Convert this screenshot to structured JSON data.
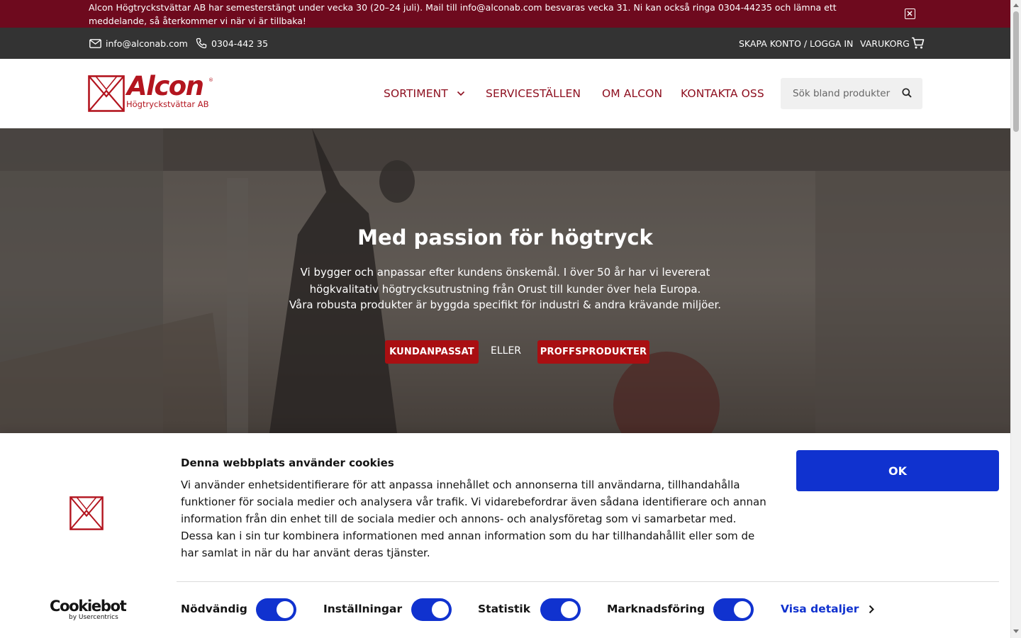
{
  "announcement": {
    "text": "Alcon Högtryckstvättar AB har semesterstängt under vecka 30 (20–24 juli). Mail till info@alconab.com besvaras vecka 31. Ni kan också ringa 0304-44235 och lämna ett meddelande, så återkommer vi när vi är tillbaka!"
  },
  "topbar": {
    "email": "info@alconab.com",
    "phone": "0304-442 35",
    "account": "SKAPA KONTO / LOGGA IN",
    "cart": "VARUKORG"
  },
  "header": {
    "logo_text": "Alcon",
    "logo_subtitle": "Högtryckstvättar AB",
    "logo_reg": "®",
    "nav": [
      "SORTIMENT",
      "SERVICESTÄLLEN",
      "OM ALCON",
      "KONTAKTA OSS"
    ],
    "search_placeholder": "Sök bland produkter"
  },
  "hero": {
    "title": "Med passion för högtryck",
    "lines": [
      "Vi bygger och anpassar efter kundens önskemål. I över 50 år har vi levererat",
      "högkvalitativ högtrycksutrustning från Orust till kunder över hela Europa.",
      "Våra robusta produkter är byggda specifikt för industri & andra krävande miljöer."
    ],
    "button_custom": "KUNDANPASSAT",
    "or_text": "ELLER",
    "button_pro": "PROFFSPRODUKTER"
  },
  "cookie": {
    "title": "Denna webbplats använder cookies",
    "body": "Vi använder enhetsidentifierare för att anpassa innehållet och annonserna till användarna, tillhandahålla funktioner för sociala medier och analysera vår trafik. Vi vidarebefordrar även sådana identifierare och annan information från din enhet till de sociala medier och annons- och analysföretag som vi samarbetar med. Dessa kan i sin tur kombinera informationen med annan information som du har tillhandahållit eller som de har samlat in när du har använt deras tjänster.",
    "ok": "OK",
    "brand": "Cookiebot",
    "brand_sub": "by Usercentrics",
    "categories": [
      {
        "label": "Nödvändig",
        "checked": true
      },
      {
        "label": "Inställningar",
        "checked": true
      },
      {
        "label": "Statistik",
        "checked": true
      },
      {
        "label": "Marknadsföring",
        "checked": true
      }
    ],
    "details": "Visa detaljer"
  },
  "colors": {
    "announce_bg": "#6e0a1e",
    "topbar_bg": "#333333",
    "brand_red": "#b3151f",
    "nav_text": "#8e1020",
    "hero_button": "#a90f12",
    "cookie_blue": "#1032cf"
  },
  "icons": {
    "close": "close-square-icon",
    "email": "envelope-icon",
    "phone": "phone-icon",
    "cart": "cart-icon",
    "search": "search-icon",
    "chevron": "chevron-down-icon",
    "details": "chevron-right-icon"
  }
}
